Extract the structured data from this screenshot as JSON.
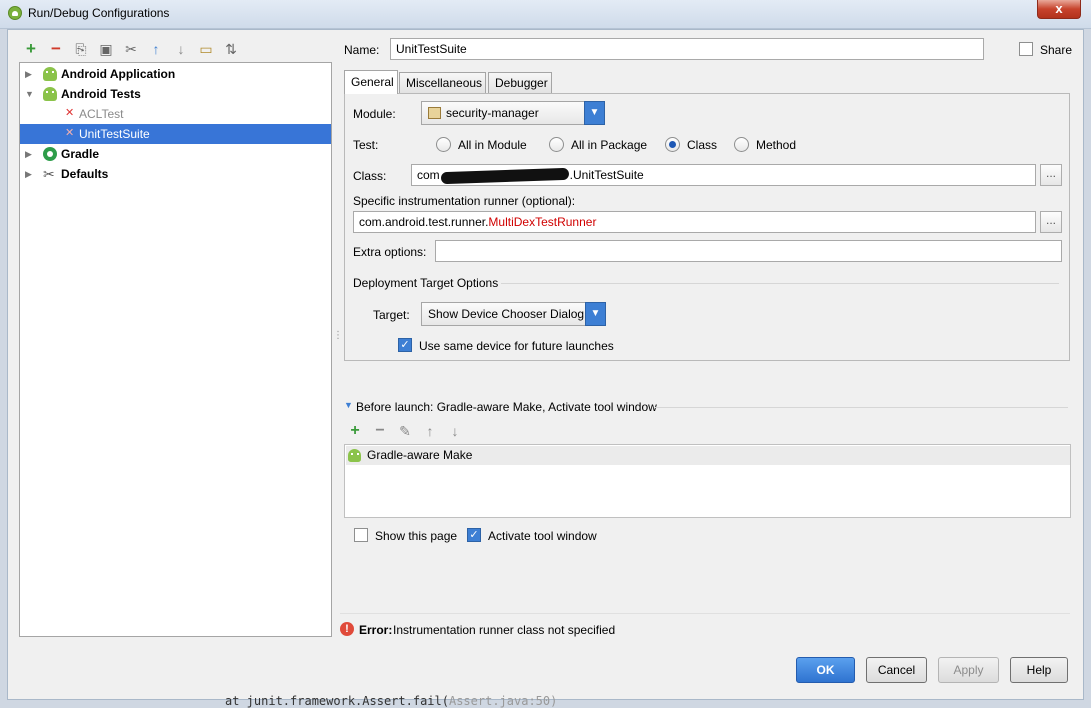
{
  "window": {
    "title": "Run/Debug Configurations",
    "close_glyph": "x"
  },
  "toolbar": {
    "icons": [
      "add-icon",
      "remove-icon",
      "copy-icon",
      "save-icon",
      "edit-defaults-icon",
      "move-up-icon",
      "move-down-icon",
      "folder-icon",
      "sort-icon"
    ],
    "add_glyph": "+",
    "remove_glyph": "−",
    "copy_glyph": "⎘",
    "save_glyph": "▣",
    "wrench_glyph": "✂",
    "up_glyph": "↑",
    "down_glyph": "↓",
    "folder_glyph": "▭",
    "sort_glyph": "⇅"
  },
  "tree": {
    "android_application": "Android Application",
    "android_tests": "Android Tests",
    "acl_test": "ACLTest",
    "unit_test_suite": "UnitTestSuite",
    "gradle": "Gradle",
    "defaults": "Defaults"
  },
  "form": {
    "name_label": "Name:",
    "name_value": "UnitTestSuite",
    "share_label": "Share",
    "tabs": [
      "General",
      "Miscellaneous",
      "Debugger"
    ],
    "module_label": "Module:",
    "module_value": "security-manager",
    "test_label": "Test:",
    "test_options": [
      "All in Module",
      "All in Package",
      "Class",
      "Method"
    ],
    "class_label": "Class:",
    "class_value_prefix": "com",
    "class_value_suffix": ".UnitTestSuite",
    "runner_label": "Specific instrumentation runner (optional):",
    "runner_value_plain": "com.android.test.runner.",
    "runner_value_red": "MultiDexTestRunner",
    "extra_label": "Extra options:",
    "extra_value": "",
    "deployment_title": "Deployment Target Options",
    "target_label": "Target:",
    "target_value": "Show Device Chooser Dialog",
    "same_device_label": "Use same device for future launches",
    "browse_glyph": "...",
    "drop_glyph": "▼"
  },
  "before_launch": {
    "title": "Before launch: Gradle-aware Make, Activate tool window",
    "item": "Gradle-aware Make",
    "show_page_label": "Show this page",
    "activate_label": "Activate tool window",
    "add_glyph": "+",
    "remove_glyph": "−",
    "edit_glyph": "✎",
    "up_glyph": "↑",
    "down_glyph": "↓"
  },
  "error": {
    "bold": "Error:",
    "message": "Instrumentation runner class not specified",
    "glyph": "!"
  },
  "buttons": {
    "ok": "OK",
    "cancel": "Cancel",
    "apply": "Apply",
    "help": "Help"
  },
  "background_code": {
    "text": "at junit.framework.Assert.fail(",
    "dim": "Assert.java:50)"
  },
  "colors": {
    "selection": "#3875d7",
    "primary_button": "#2f73d0",
    "error": "#e04a3a",
    "runner_red": "#d00000"
  }
}
